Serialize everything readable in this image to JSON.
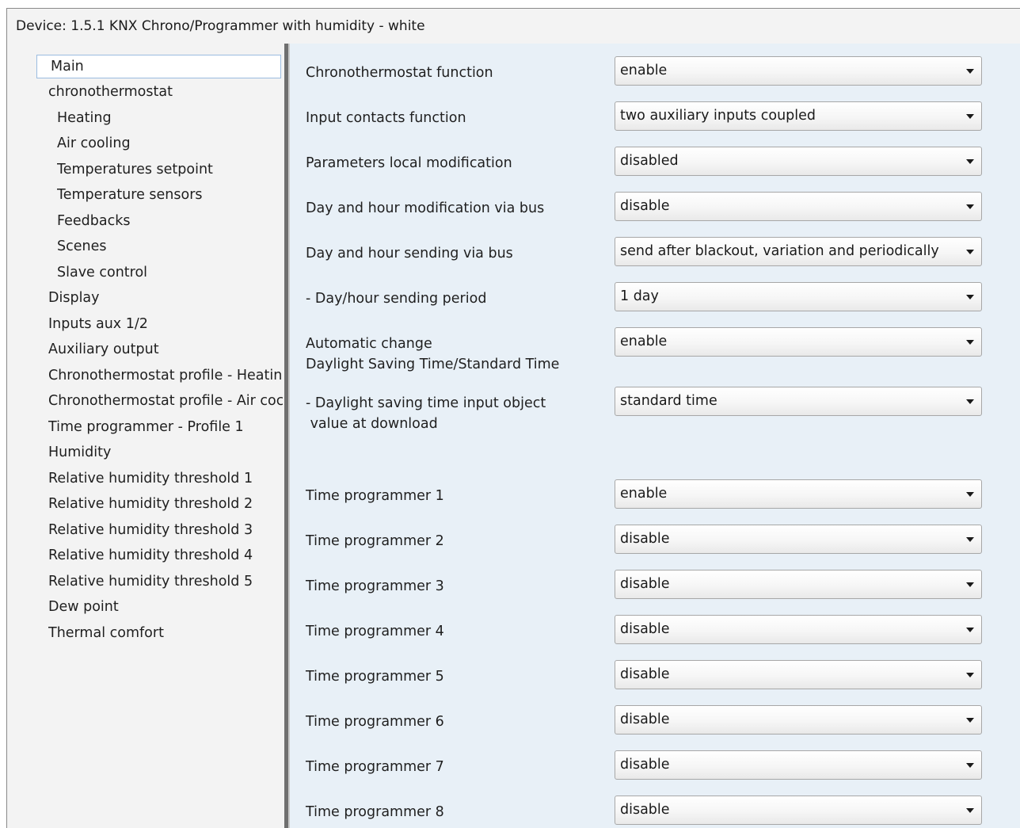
{
  "window": {
    "title": "Device: 1.5.1  KNX Chrono/Programmer with humidity - white"
  },
  "sidebar": {
    "items": [
      {
        "label": "Main",
        "selected": true
      },
      {
        "label": "chronothermostat"
      },
      {
        "label": "Heating"
      },
      {
        "label": "Air cooling"
      },
      {
        "label": "Temperatures setpoint"
      },
      {
        "label": "Temperature sensors"
      },
      {
        "label": "Feedbacks"
      },
      {
        "label": "Scenes"
      },
      {
        "label": "Slave control"
      },
      {
        "label": "Display"
      },
      {
        "label": "Inputs aux 1/2"
      },
      {
        "label": "Auxiliary output"
      },
      {
        "label": "Chronothermostat profile - Heatin"
      },
      {
        "label": "Chronothermostat profile - Air coc"
      },
      {
        "label": "Time programmer - Profile 1"
      },
      {
        "label": "Humidity"
      },
      {
        "label": "Relative humidity threshold 1"
      },
      {
        "label": "Relative humidity threshold 2"
      },
      {
        "label": "Relative humidity threshold 3"
      },
      {
        "label": "Relative humidity threshold 4"
      },
      {
        "label": "Relative humidity threshold 5"
      },
      {
        "label": "Dew point"
      },
      {
        "label": "Thermal comfort"
      }
    ]
  },
  "params": [
    {
      "label": "Chronothermostat function",
      "value": "enable"
    },
    {
      "label": "Input contacts function",
      "value": "two auxiliary inputs coupled"
    },
    {
      "label": "Parameters local modification",
      "value": "disabled"
    },
    {
      "label": "Day and hour modification via bus",
      "value": "disable"
    },
    {
      "label": "Day and hour sending via bus",
      "value": "send after blackout, variation and periodically"
    },
    {
      "label": "- Day/hour sending period",
      "value": "1 day"
    },
    {
      "label": "Automatic change",
      "label2": "Daylight Saving Time/Standard Time",
      "value": "enable"
    },
    {
      "label": "- Daylight saving time input object",
      "label2": " value at download",
      "value": "standard time"
    },
    {
      "label": "Time programmer 1",
      "value": "enable"
    },
    {
      "label": "Time programmer 2",
      "value": "disable"
    },
    {
      "label": "Time programmer 3",
      "value": "disable"
    },
    {
      "label": "Time programmer 4",
      "value": "disable"
    },
    {
      "label": "Time programmer 5",
      "value": "disable"
    },
    {
      "label": "Time programmer 6",
      "value": "disable"
    },
    {
      "label": "Time programmer 7",
      "value": "disable"
    },
    {
      "label": "Time programmer 8",
      "value": "disable"
    }
  ],
  "icons": {
    "dropdown": "chevron-down-icon"
  }
}
